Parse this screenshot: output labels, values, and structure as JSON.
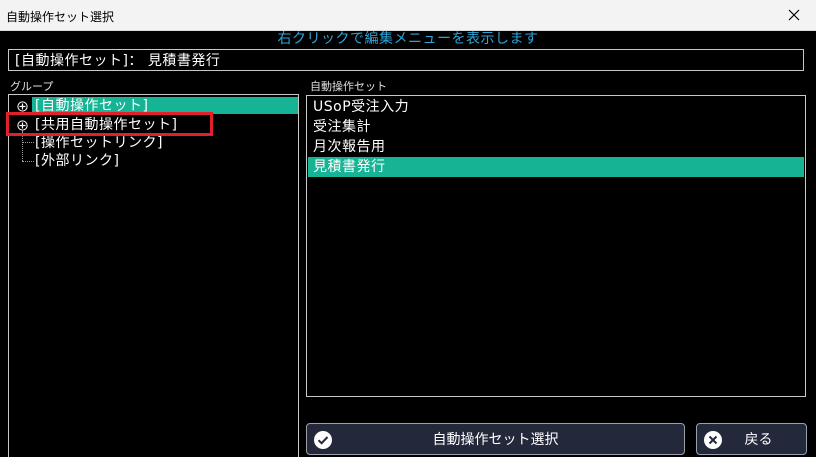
{
  "window": {
    "title": "自動操作セット選択"
  },
  "hint": "右クリックで編集メニューを表示します",
  "current": "[自動操作セット]： 見積書発行",
  "group_panel": {
    "label": "グループ",
    "items": [
      {
        "label": "[自動操作セット]",
        "expandable": true,
        "selected": true
      },
      {
        "label": "[共用自動操作セット]",
        "expandable": true,
        "selected": false
      },
      {
        "label": "[操作セットリンク]",
        "expandable": false,
        "selected": false
      },
      {
        "label": "[外部リンク]",
        "expandable": false,
        "selected": false
      }
    ]
  },
  "set_panel": {
    "label": "自動操作セット",
    "items": [
      {
        "label": "USoP受注入力",
        "selected": false
      },
      {
        "label": "受注集計",
        "selected": false
      },
      {
        "label": "月次報告用",
        "selected": false
      },
      {
        "label": "見積書発行",
        "selected": true
      }
    ]
  },
  "buttons": {
    "select": {
      "label": "自動操作セット選択",
      "icon": "check-circle-icon"
    },
    "back": {
      "label": "戻る",
      "icon": "x-circle-icon"
    }
  },
  "colors": {
    "accent": "#17b395",
    "hint": "#2fa3d6",
    "highlight_box": "#e0202a",
    "button_bg": "#23283a"
  }
}
